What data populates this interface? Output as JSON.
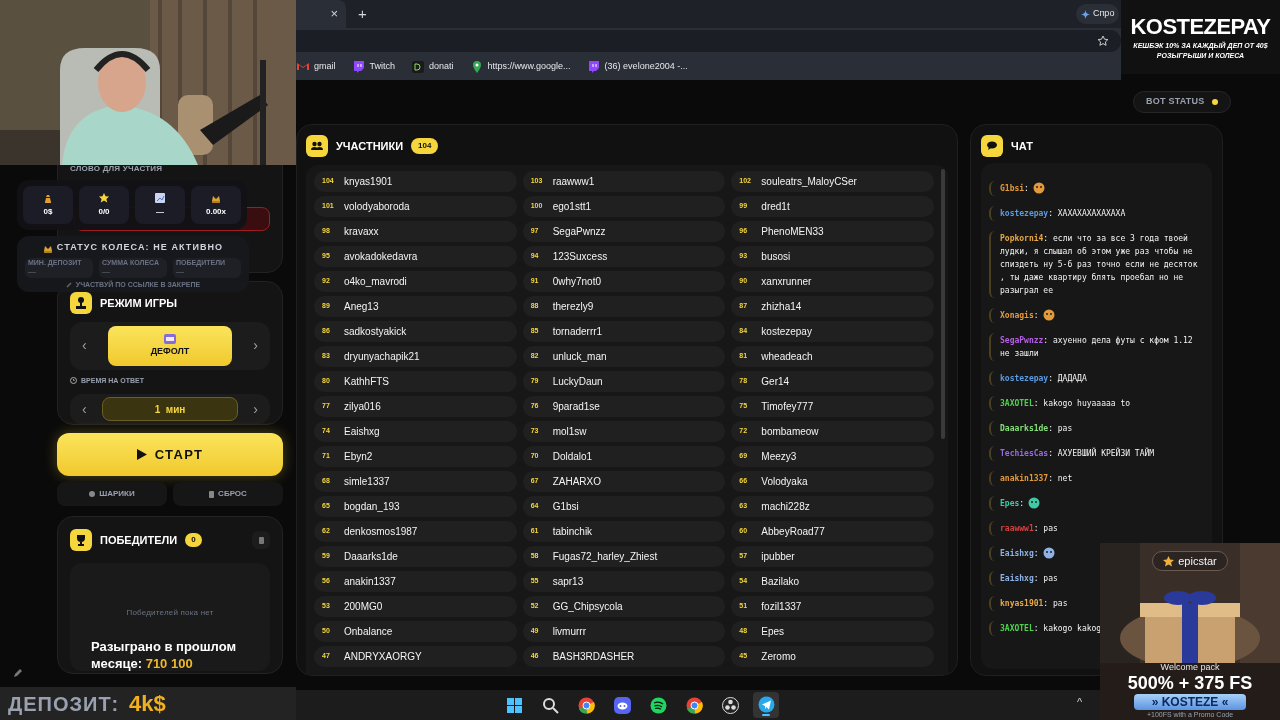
{
  "browser": {
    "close_tab": "×",
    "new_tab": "+",
    "side_button": "Спро",
    "bookmarks": [
      {
        "label": "gmail",
        "kind": "gmail"
      },
      {
        "label": "Twitch",
        "kind": "twitch"
      },
      {
        "label": "donati",
        "kind": "donati"
      },
      {
        "label": "https://www.google...",
        "kind": "maps"
      },
      {
        "label": "(36) evelone2004 -...",
        "kind": "twitch"
      }
    ]
  },
  "bot_status": {
    "label": "BOT STATUS",
    "online": true
  },
  "left_panel": {
    "word_label": "СЛОВО ДЛЯ УЧАСТИЯ",
    "mode": {
      "title": "РЕЖИМ ИГРЫ",
      "value": "ДЕФОЛТ",
      "prev": "‹",
      "next": "›"
    },
    "time": {
      "label": "ВРЕМЯ НА ОТВЕТ",
      "value": "1  мин",
      "prev": "‹",
      "next": "›"
    },
    "start": "СТАРТ",
    "balls": "ШАРИКИ",
    "reset": "СБРОС",
    "winners": {
      "title": "ПОБЕДИТЕЛИ",
      "count": "0",
      "empty": "Победителей пока нет"
    }
  },
  "participants": {
    "title": "УЧАСТНИКИ",
    "count": "104",
    "items": [
      {
        "num": "104",
        "name": "knyas1901"
      },
      {
        "num": "103",
        "name": "raawww1"
      },
      {
        "num": "102",
        "name": "souleatrs_MaloyCSer"
      },
      {
        "num": "101",
        "name": "volodyaboroda"
      },
      {
        "num": "100",
        "name": "ego1stt1"
      },
      {
        "num": "99",
        "name": "dred1t"
      },
      {
        "num": "98",
        "name": "kravaxx"
      },
      {
        "num": "97",
        "name": "SegaPwnzz"
      },
      {
        "num": "96",
        "name": "PhenoMEN33"
      },
      {
        "num": "95",
        "name": "avokadokedavra"
      },
      {
        "num": "94",
        "name": "123Suxcess"
      },
      {
        "num": "93",
        "name": "busosi"
      },
      {
        "num": "92",
        "name": "o4ko_mavrodi"
      },
      {
        "num": "91",
        "name": "0why7not0"
      },
      {
        "num": "90",
        "name": "xanxrunner"
      },
      {
        "num": "89",
        "name": "Aneg13"
      },
      {
        "num": "88",
        "name": "therezly9"
      },
      {
        "num": "87",
        "name": "zhizha14"
      },
      {
        "num": "86",
        "name": "sadkostyakick"
      },
      {
        "num": "85",
        "name": "tornaderrr1"
      },
      {
        "num": "84",
        "name": "kostezepay"
      },
      {
        "num": "83",
        "name": "dryunyachapik21"
      },
      {
        "num": "82",
        "name": "unluck_man"
      },
      {
        "num": "81",
        "name": "wheadeach"
      },
      {
        "num": "80",
        "name": "KathhFTS"
      },
      {
        "num": "79",
        "name": "LuckyDaun"
      },
      {
        "num": "78",
        "name": "Ger14"
      },
      {
        "num": "77",
        "name": "zilya016"
      },
      {
        "num": "76",
        "name": "9parad1se"
      },
      {
        "num": "75",
        "name": "Timofey777"
      },
      {
        "num": "74",
        "name": "Eaishxg"
      },
      {
        "num": "73",
        "name": "mol1sw"
      },
      {
        "num": "72",
        "name": "bombameow"
      },
      {
        "num": "71",
        "name": "Ebyn2"
      },
      {
        "num": "70",
        "name": "Doldalo1"
      },
      {
        "num": "69",
        "name": "Meezy3"
      },
      {
        "num": "68",
        "name": "simle1337"
      },
      {
        "num": "67",
        "name": "ZAHARXO"
      },
      {
        "num": "66",
        "name": "Volodyaka"
      },
      {
        "num": "65",
        "name": "bogdan_193"
      },
      {
        "num": "64",
        "name": "G1bsi"
      },
      {
        "num": "63",
        "name": "machi228z"
      },
      {
        "num": "62",
        "name": "denkosmos1987"
      },
      {
        "num": "61",
        "name": "tabinchik"
      },
      {
        "num": "60",
        "name": "AbbeyRoad77"
      },
      {
        "num": "59",
        "name": "Daaarks1de"
      },
      {
        "num": "58",
        "name": "Fugas72_harley_Zhiest"
      },
      {
        "num": "57",
        "name": "ipubber"
      },
      {
        "num": "56",
        "name": "anakin1337"
      },
      {
        "num": "55",
        "name": "sapr13"
      },
      {
        "num": "54",
        "name": "Bazilako"
      },
      {
        "num": "53",
        "name": "200MG0"
      },
      {
        "num": "52",
        "name": "GG_Chipsycola"
      },
      {
        "num": "51",
        "name": "fozil1337"
      },
      {
        "num": "50",
        "name": "Onbalance"
      },
      {
        "num": "49",
        "name": "livmurrr"
      },
      {
        "num": "48",
        "name": "Epes"
      },
      {
        "num": "47",
        "name": "ANDRYXAORGY"
      },
      {
        "num": "46",
        "name": "BASH3RDASHER"
      },
      {
        "num": "45",
        "name": "Zeromo"
      }
    ]
  },
  "chat": {
    "title": "ЧАТ",
    "separator": ":",
    "messages": [
      {
        "kind": "emote",
        "user": "G1bsi",
        "color": "#e39a3b"
      },
      {
        "kind": "text",
        "user": "kostezepay",
        "color": "#5b9be0",
        "text": "ХАХАХАХАХАХАХА"
      },
      {
        "kind": "text",
        "user": "Popkorni4",
        "color": "#e8a845",
        "text": "если что за все 3 года твоей лудки, я слышал об этом уже раз чтобы не спиздеть ну 5-6 раз точно если не десяток , ты даже квартиру блять проебал но не разыграл ее"
      },
      {
        "kind": "emote",
        "user": "Xonagis",
        "color": "#e39a3b"
      },
      {
        "kind": "text",
        "user": "SegaPwnzz",
        "color": "#b65ee6",
        "text": "ахуенно дела футы с кфом 1.12 не зашли"
      },
      {
        "kind": "text",
        "user": "kostezepay",
        "color": "#5b9be0",
        "text": "ДАДАДА"
      },
      {
        "kind": "text",
        "user": "3AXOTEL",
        "color": "#4fd14f",
        "text": "kakogo huyaaaaa to"
      },
      {
        "kind": "text",
        "user": "Daaarks1de",
        "color": "#86e07a",
        "text": "pas"
      },
      {
        "kind": "text",
        "user": "TechiesCas",
        "color": "#9a6ae6",
        "text": "АХУЕВШИЙ КРЕЙЗИ ТАЙМ"
      },
      {
        "kind": "text",
        "user": "anakin1337",
        "color": "#e39a3b",
        "text": "net"
      },
      {
        "kind": "emote",
        "user": "Epes",
        "color": "#3fc9a4"
      },
      {
        "kind": "text",
        "user": "raawww1",
        "color": "#d44040",
        "text": "pas"
      },
      {
        "kind": "emote",
        "user": "Eaishxg",
        "color": "#8fb3e6"
      },
      {
        "kind": "text",
        "user": "Eaishxg",
        "color": "#8fb3e6",
        "text": "pas"
      },
      {
        "kind": "text",
        "user": "knyas1901",
        "color": "#e8a845",
        "text": "pas"
      },
      {
        "kind": "text",
        "user": "3AXOTEL",
        "color": "#4fd14f",
        "text": "kakogo kakog"
      }
    ]
  },
  "overlays": {
    "stats": [
      {
        "kind": "money",
        "value": "0$"
      },
      {
        "kind": "star",
        "value": "0/0"
      },
      {
        "kind": "chart",
        "value": "—"
      },
      {
        "kind": "crown",
        "value": "0.00x"
      }
    ],
    "wheel": {
      "title": "СТАТУС КОЛЕСА: НЕ АКТИВНО",
      "cells": [
        {
          "label": "МИН. ДЕПОЗИТ",
          "value": "—"
        },
        {
          "label": "СУММА КОЛЕСА",
          "value": "—"
        },
        {
          "label": "ПОБЕДИТЕЛИ",
          "value": "—"
        }
      ],
      "footer": "УЧАСТВУЙ ПО ССЫЛКЕ В ЗАКРЕПЕ"
    },
    "last_month_label": "Разыграно в прошлом месяце:",
    "last_month_value": "710 100",
    "deposit_label": "ДЕПОЗИТ:",
    "deposit_value": "4k$",
    "banner": {
      "title": "KOSTEZEPAY",
      "line_1": "КЕШБЭК 10% ЗА КАЖДЫЙ ДЕП ОТ 40$",
      "line_2": "РОЗЫГРЫШИ И КОЛЕСА"
    },
    "ad": {
      "brand": "epicstar",
      "pack": "Welcome pack",
      "offer": "500% + 375 FS",
      "code": "» KOSTEZE «",
      "note": "+100FS with a Promo Code"
    }
  },
  "taskbar": {
    "tray_arrow": "^",
    "apps": [
      {
        "kind": "windows",
        "selected": false
      },
      {
        "kind": "search",
        "selected": false
      },
      {
        "kind": "chrome",
        "selected": false
      },
      {
        "kind": "discord",
        "selected": false
      },
      {
        "kind": "spotify",
        "selected": false
      },
      {
        "kind": "chrome",
        "selected": false
      },
      {
        "kind": "obs",
        "selected": false
      },
      {
        "kind": "telegram",
        "selected": true
      }
    ]
  }
}
